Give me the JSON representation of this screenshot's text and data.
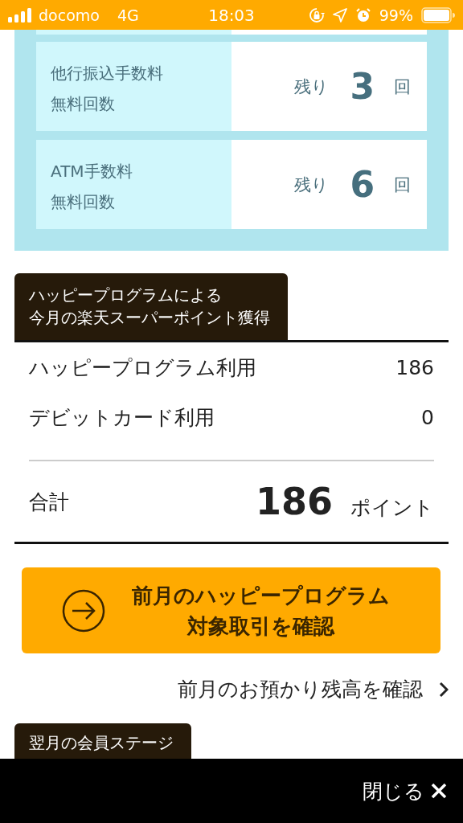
{
  "status_bar": {
    "carrier": "docomo",
    "network": "4G",
    "time": "18:03",
    "battery": "99%"
  },
  "free_counts": [
    {
      "label": [
        "他行振込手数料",
        "無料回数"
      ],
      "prefix": "残り",
      "count": "3",
      "unit": "回"
    },
    {
      "label": [
        "ATM手数料",
        "無料回数"
      ],
      "prefix": "残り",
      "count": "6",
      "unit": "回"
    }
  ],
  "points_section": {
    "title": [
      "ハッピープログラムによる",
      "今月の楽天スーパーポイント獲得"
    ],
    "rows": [
      {
        "label": "ハッピープログラム利用",
        "value": "186"
      },
      {
        "label": "デビットカード利用",
        "value": "0"
      }
    ],
    "total": {
      "label": "合計",
      "value": "186",
      "unit": "ポイント"
    }
  },
  "confirm_button": [
    "前月のハッピープログラム",
    "対象取引を確認"
  ],
  "balance_link": "前月のお預かり残高を確認",
  "next_section": {
    "title": "翌月の会員ステージ"
  },
  "bottom_bar": {
    "close": "閉じる"
  }
}
